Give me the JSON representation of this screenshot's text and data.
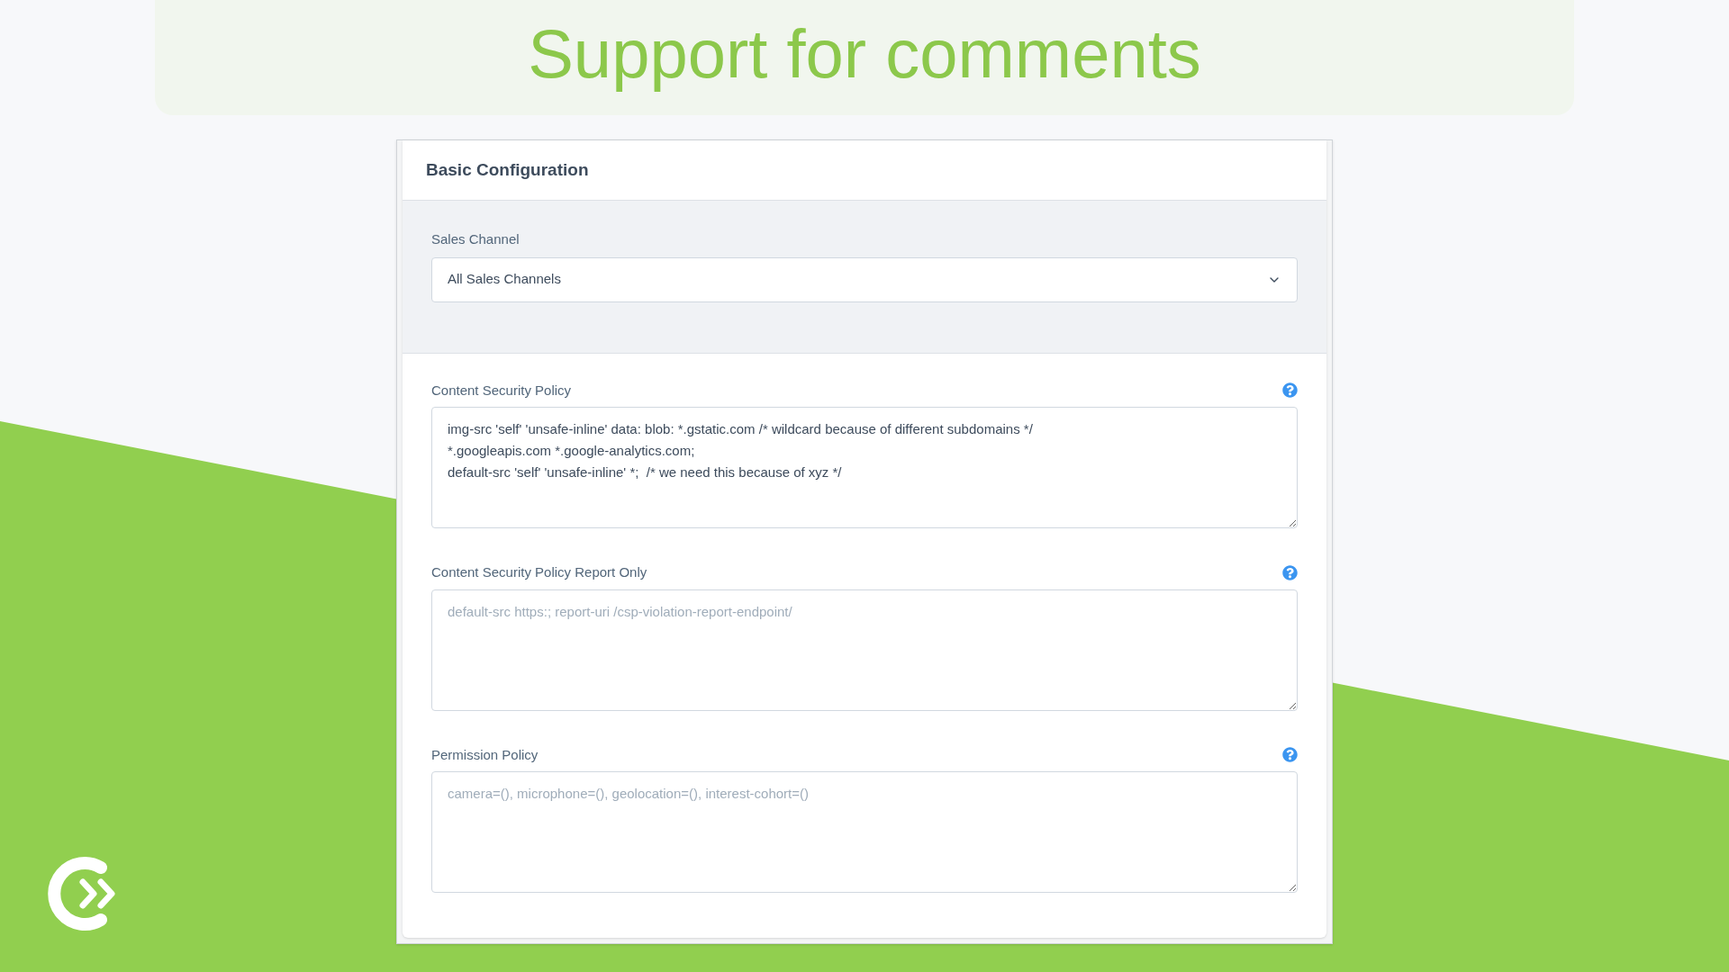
{
  "banner": {
    "title": "Support for comments"
  },
  "card": {
    "title": "Basic Configuration",
    "sales_channel": {
      "label": "Sales Channel",
      "value": "All Sales Channels"
    },
    "fields": [
      {
        "label": "Content Security Policy",
        "value": "img-src 'self' 'unsafe-inline' data: blob: *.gstatic.com /* wildcard because of different subdomains */\n*.googleapis.com *.google-analytics.com;\ndefault-src 'self' 'unsafe-inline' *;  /* we need this because of xyz */"
      },
      {
        "label": "Content Security Policy Report Only",
        "placeholder": "default-src https:; report-uri /csp-violation-report-endpoint/"
      },
      {
        "label": "Permission Policy",
        "placeholder": "camera=(), microphone=(), geolocation=(), interest-cohort=()"
      }
    ]
  }
}
